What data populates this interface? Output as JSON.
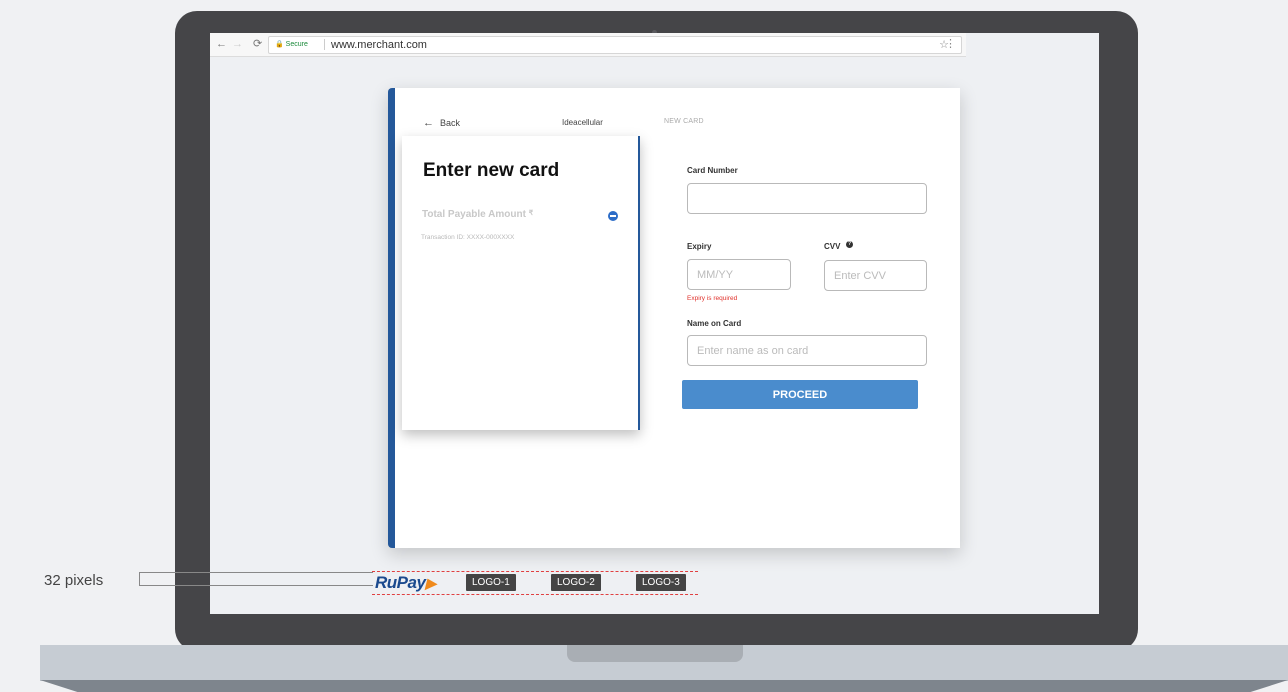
{
  "browser": {
    "secure_label": "Secure",
    "url": "www.merchant.com",
    "back_icon": "←",
    "forward_icon": "→",
    "reload_icon": "⟳",
    "star_icon": "☆",
    "menu_icon": "⋮"
  },
  "header": {
    "back_label": "Back",
    "merchant_name": "Ideacellular",
    "tab_label": "NEW CARD"
  },
  "left_panel": {
    "title": "Enter new card",
    "amount_label": "Total Payable Amount",
    "currency_symbol": "₹",
    "transaction_label": "Transaction ID:",
    "transaction_id": "XXXX-000XXXX"
  },
  "form": {
    "card_number_label": "Card Number",
    "card_number_value": "",
    "expiry_label": "Expiry",
    "expiry_placeholder": "MM/YY",
    "expiry_error": "Expiry is required",
    "cvv_label": "CVV",
    "cvv_placeholder": "Enter CVV",
    "name_label": "Name on Card",
    "name_placeholder": "Enter name as on card",
    "proceed_label": "PROCEED"
  },
  "logos": {
    "rupay": "RuPay",
    "logo1": "LOGO-1",
    "logo2": "LOGO-2",
    "logo3": "LOGO-3"
  },
  "annotation": {
    "label": "32 pixels"
  },
  "colors": {
    "accent": "#24589a",
    "button": "#4a8ccd",
    "error": "#e0312b"
  }
}
